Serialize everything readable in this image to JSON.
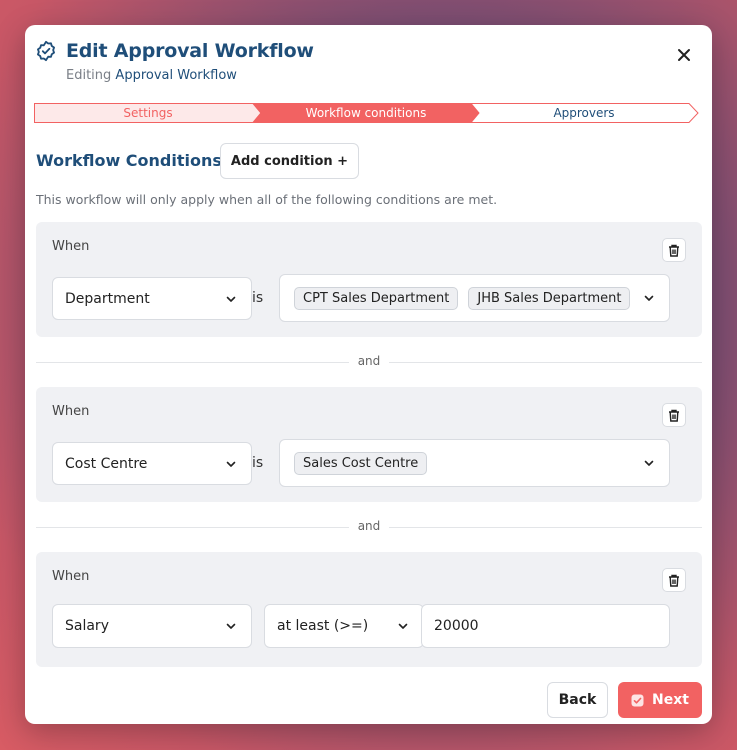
{
  "header": {
    "title": "Edit Approval Workflow",
    "subtitle_prefix": "Editing ",
    "subtitle_highlight": "Approval Workflow"
  },
  "stepper": {
    "steps": [
      "Settings",
      "Workflow conditions",
      "Approvers"
    ],
    "active_index": 1
  },
  "section": {
    "title": "Workflow Conditions",
    "add_label": "Add condition +",
    "description": "This workflow will only apply when all of the following conditions are met."
  },
  "conditions": [
    {
      "when": "When",
      "field": "Department",
      "operator": "is",
      "values": [
        "CPT Sales Department",
        "JHB Sales Department"
      ]
    },
    {
      "when": "When",
      "field": "Cost Centre",
      "operator": "is",
      "values": [
        "Sales Cost Centre"
      ]
    },
    {
      "when": "When",
      "field": "Salary",
      "operator": "at least (>=)",
      "value": "20000"
    }
  ],
  "joiners": [
    "and",
    "and"
  ],
  "footer": {
    "back_label": "Back",
    "next_label": "Next"
  },
  "colors": {
    "accent": "#f26262",
    "primary_text": "#1f4e79"
  }
}
